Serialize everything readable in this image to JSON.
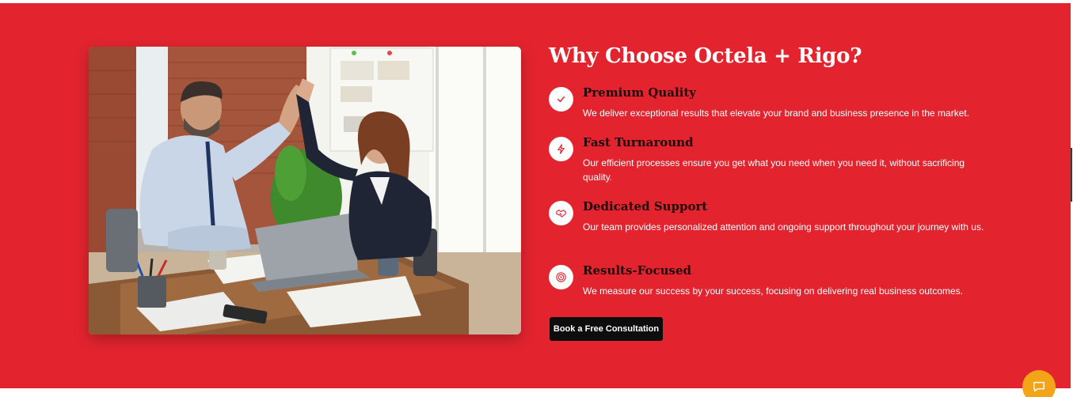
{
  "section": {
    "background": "#e3242f",
    "heading": "Why Choose Octela + Rigo?",
    "image_alt": "Two colleagues giving a high five in an office",
    "features": [
      {
        "icon": "check-icon",
        "title": "Premium Quality",
        "description": "We deliver exceptional results that elevate your brand and business presence in the market."
      },
      {
        "icon": "lightning-icon",
        "title": "Fast Turnaround",
        "description": "Our efficient processes ensure you get what you need when you need it, without sacrificing quality."
      },
      {
        "icon": "handshake-icon",
        "title": "Dedicated Support",
        "description": "Our team provides personalized attention and ongoing support throughout your journey with us."
      },
      {
        "icon": "target-icon",
        "title": "Results-Focused",
        "description": "We measure our success by your success, focusing on delivering real business outcomes."
      }
    ],
    "cta_label": "Book a Free Consultation"
  },
  "chat_widget": {
    "icon": "chat-bubble-icon",
    "color": "#f3a417"
  }
}
